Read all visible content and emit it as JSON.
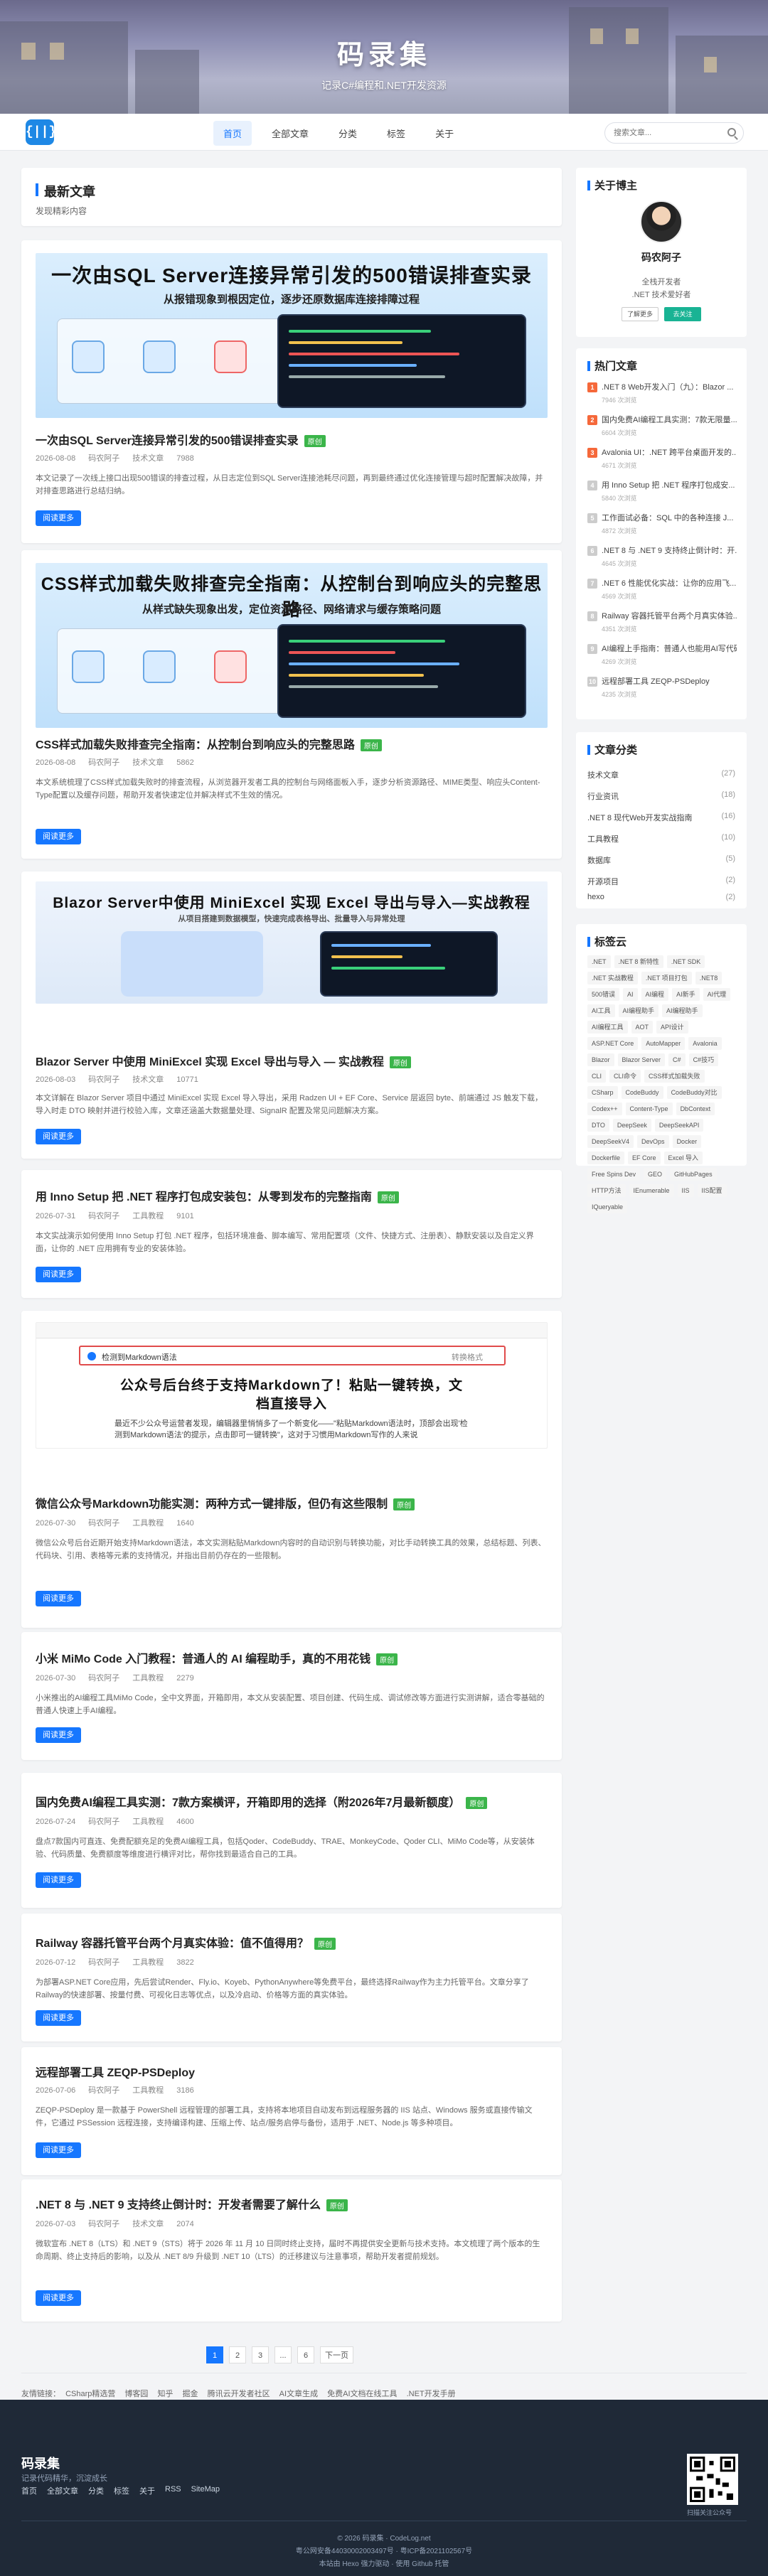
{
  "site": {
    "title": "码录集",
    "subtitle": "记录C#编程和.NET开发资源"
  },
  "nav": {
    "logo": "{||}",
    "items": [
      "首页",
      "全部文章",
      "分类",
      "标签",
      "关于"
    ],
    "search_placeholder": "搜索文章..."
  },
  "latest": {
    "title": "最新文章",
    "subtitle": "发现精彩内容"
  },
  "posts": [
    {
      "banner_title": "一次由SQL Server连接异常引发的500错误排查实录",
      "banner_sub": "从报错现象到根因定位，逐步还原数据库连接排障过程",
      "title": "一次由SQL Server连接异常引发的500错误排查实录",
      "badge": "原创",
      "date": "2026-08-08",
      "author": "码农阿子",
      "category": "技术文章",
      "views": "7988",
      "desc": "本文记录了一次线上接口出现500错误的排查过程，从日志定位到SQL Server连接池耗尽问题，再到最终通过优化连接管理与超时配置解决故障，并对排查思路进行总结归纳。",
      "more": "阅读更多"
    },
    {
      "banner_title": "CSS样式加载失败排查完全指南：从控制台到响应头的完整思路",
      "banner_sub": "从样式缺失现象出发，定位资源路径、网络请求与缓存策略问题",
      "title": "CSS样式加载失败排查完全指南：从控制台到响应头的完整思路",
      "badge": "原创",
      "date": "2026-08-08",
      "author": "码农阿子",
      "category": "技术文章",
      "views": "5862",
      "desc": "本文系统梳理了CSS样式加载失败时的排查流程，从浏览器开发者工具的控制台与网络面板入手，逐步分析资源路径、MIME类型、响应头Content-Type配置以及缓存问题，帮助开发者快速定位并解决样式不生效的情况。",
      "more": "阅读更多"
    },
    {
      "banner_title": "Blazor Server中使用 MiniExcel 实现 Excel 导出与导入—实战教程",
      "banner_sub": "从项目搭建到数据模型，快速完成表格导出、批量导入与异常处理",
      "title": "Blazor Server 中使用 MiniExcel 实现 Excel 导出与导入 — 实战教程",
      "badge": "原创",
      "date": "2026-08-03",
      "author": "码农阿子",
      "category": "技术文章",
      "views": "10771",
      "desc": "本文详解在 Blazor Server 项目中通过 MiniExcel 实现 Excel 导入导出，采用 Radzen UI + EF Core、Service 层返回 byte、前端通过 JS 触发下载，导入时走 DTO 映射并进行校验入库，文章还涵盖大数据量处理、SignalR 配置及常见问题解决方案。",
      "more": "阅读更多"
    },
    {
      "title": "用 Inno Setup 把 .NET 程序打包成安装包：从零到发布的完整指南",
      "badge": "原创",
      "date": "2026-07-31",
      "author": "码农阿子",
      "category": "工具教程",
      "views": "9101",
      "desc": "本文实战演示如何使用 Inno Setup 打包 .NET 程序，包括环境准备、脚本编写、常用配置项（文件、快捷方式、注册表）、静默安装以及自定义界面，让你的 .NET 应用拥有专业的安装体验。",
      "more": "阅读更多"
    },
    {
      "banner_title": "公众号后台终于支持Markdown了！粘贴一键转换，文档直接导入",
      "banner_sub": "最近不少公众号运营者发现，编辑器里悄悄多了一个新变化——\"粘贴Markdown语法时，顶部会出现'检测到Markdown语法'的提示，点击即可一键转换\"，这对于习惯用Markdown写作的人来说",
      "banner_bar": "检测到Markdown语法",
      "banner_btn": "转换格式",
      "title": "微信公众号Markdown功能实测：两种方式一键排版，但仍有这些限制",
      "badge": "原创",
      "date": "2026-07-30",
      "author": "码农阿子",
      "category": "工具教程",
      "views": "1640",
      "desc": "微信公众号后台近期开始支持Markdown语法，本文实测粘贴Markdown内容时的自动识别与转换功能，对比手动转换工具的效果，总结标题、列表、代码块、引用、表格等元素的支持情况，并指出目前仍存在的一些限制。",
      "more": "阅读更多"
    },
    {
      "title": "小米 MiMo Code 入门教程：普通人的 AI 编程助手，真的不用花钱",
      "badge": "原创",
      "date": "2026-07-30",
      "author": "码农阿子",
      "category": "工具教程",
      "views": "2279",
      "desc": "小米推出的AI编程工具MiMo Code，全中文界面，开箱即用，本文从安装配置、项目创建、代码生成、调试修改等方面进行实测讲解，适合零基础的普通人快速上手AI编程。",
      "more": "阅读更多"
    },
    {
      "title": "国内免费AI编程工具实测：7款方案横评，开箱即用的选择（附2026年7月最新额度）",
      "badge": "原创",
      "date": "2026-07-24",
      "author": "码农阿子",
      "category": "工具教程",
      "views": "4600",
      "desc": "盘点7款国内可直连、免费配额充足的免费AI编程工具，包括Qoder、CodeBuddy、TRAE、MonkeyCode、Qoder CLI、MiMo Code等，从安装体验、代码质量、免费额度等维度进行横评对比，帮你找到最适合自己的工具。",
      "more": "阅读更多"
    },
    {
      "title": "Railway 容器托管平台两个月真实体验：值不值得用？",
      "badge": "原创",
      "date": "2026-07-12",
      "author": "码农阿子",
      "category": "工具教程",
      "views": "3822",
      "desc": "为部署ASP.NET Core应用，先后尝试Render、Fly.io、Koyeb、PythonAnywhere等免费平台，最终选择Railway作为主力托管平台。文章分享了Railway的快速部署、按量付费、可视化日志等优点，以及冷启动、价格等方面的真实体验。",
      "more": "阅读更多"
    },
    {
      "title": "远程部署工具 ZEQP-PSDeploy",
      "date": "2026-07-06",
      "author": "码农阿子",
      "category": "工具教程",
      "views": "3186",
      "desc": "ZEQP-PSDeploy 是一款基于 PowerShell 远程管理的部署工具，支持将本地项目自动发布到远程服务器的 IIS 站点、Windows 服务或直接传输文件，它通过 PSSession 远程连接，支持编译构建、压缩上传、站点/服务启停与备份，适用于 .NET、Node.js 等多种项目。",
      "more": "阅读更多"
    },
    {
      "title": ".NET 8 与 .NET 9 支持终止倒计时：开发者需要了解什么",
      "badge": "原创",
      "date": "2026-07-03",
      "author": "码农阿子",
      "category": "技术文章",
      "views": "2074",
      "desc": "微软宣布 .NET 8（LTS）和 .NET 9（STS）将于 2026 年 11 月 10 日同时终止支持，届时不再提供安全更新与技术支持。本文梳理了两个版本的生命周期、终止支持后的影响，以及从 .NET 8/9 升级到 .NET 10（LTS）的迁移建议与注意事项，帮助开发者提前规划。",
      "more": "阅读更多"
    }
  ],
  "pager": [
    "1",
    "2",
    "3",
    "...",
    "6",
    "下一页"
  ],
  "links": {
    "label": "友情链接：",
    "items": [
      "CSharp精选营",
      "博客园",
      "知乎",
      "掘金",
      "腾讯云开发者社区",
      "AI文章生成",
      "免费AI文档在线工具",
      ".NET开发手册"
    ]
  },
  "author": {
    "title": "关于博主",
    "name": "码农阿子",
    "line1": "全栈开发者",
    "line2": ".NET 技术爱好者",
    "btn1": "了解更多",
    "btn2": "去关注"
  },
  "hot": {
    "title": "热门文章",
    "items": [
      {
        "title": ".NET 8 Web开发入门（九）：Blazor ...",
        "views": "7946 次浏览"
      },
      {
        "title": "国内免费AI编程工具实测：7款无限量...",
        "views": "6604 次浏览"
      },
      {
        "title": "Avalonia UI：.NET 跨平台桌面开发的...",
        "views": "4671 次浏览"
      },
      {
        "title": "用 Inno Setup 把 .NET 程序打包成安...",
        "views": "5840 次浏览"
      },
      {
        "title": "工作面试必备：SQL 中的各种连接 J...",
        "views": "4872 次浏览"
      },
      {
        "title": ".NET 8 与 .NET 9 支持终止倒计时：开...",
        "views": "4645 次浏览"
      },
      {
        "title": ".NET 6 性能优化实战：让你的应用飞...",
        "views": "4569 次浏览"
      },
      {
        "title": "Railway 容器托管平台两个月真实体验...",
        "views": "4351 次浏览"
      },
      {
        "title": "AI编程上手指南：普通人也能用AI写代码...",
        "views": "4269 次浏览"
      },
      {
        "title": "远程部署工具 ZEQP-PSDeploy",
        "views": "4235 次浏览"
      }
    ]
  },
  "categories": {
    "title": "文章分类",
    "items": [
      {
        "name": "技术文章",
        "count": "(27)"
      },
      {
        "name": "行业资讯",
        "count": "(18)"
      },
      {
        "name": ".NET 8 现代Web开发实战指南",
        "count": "(16)"
      },
      {
        "name": "工具教程",
        "count": "(10)"
      },
      {
        "name": "数据库",
        "count": "(5)"
      },
      {
        "name": "开源项目",
        "count": "(2)"
      },
      {
        "name": "hexo",
        "count": "(2)"
      }
    ]
  },
  "tagcloud": {
    "title": "标签云",
    "items": [
      ".NET",
      ".NET 8 新特性",
      ".NET SDK",
      ".NET 实战教程",
      ".NET 项目打包",
      ".NET8",
      "500错误",
      "AI",
      "AI编程",
      "AI新手",
      "AI代理",
      "AI工具",
      "AI编程助手",
      "AI编程助手",
      "AI编程工具",
      "AOT",
      "API设计",
      "ASP.NET Core",
      "AutoMapper",
      "Avalonia",
      "Blazor",
      "Blazor Server",
      "C#",
      "C#技巧",
      "CLI",
      "CLI命令",
      "CSS样式加载失败",
      "CSharp",
      "CodeBuddy",
      "CodeBuddy对比",
      "Codex++",
      "Content-Type",
      "DbContext",
      "DTO",
      "DeepSeek",
      "DeepSeekAPI",
      "DeepSeekV4",
      "DevOps",
      "Docker",
      "Dockerfile",
      "EF Core",
      "Excel 导入",
      "Free Spins Dev",
      "GEO",
      "GitHubPages",
      "HTTP方法",
      "IEnumerable",
      "IIS",
      "IIS配置",
      "IQueryable"
    ]
  },
  "footer": {
    "brand": "码录集",
    "desc": "记录代码精华，沉淀成长",
    "links": [
      "首页",
      "全部文章",
      "分类",
      "标签",
      "关于",
      "RSS",
      "SiteMap"
    ],
    "qr_text": "扫描关注公众号",
    "copyright": "© 2026 码录集 · CodeLog.net",
    "icp": "粤公网安备44030002003497号 · 粤ICP备2021102567号",
    "tech": "本站由 Hexo 强力驱动 · 使用 Github 托管"
  }
}
